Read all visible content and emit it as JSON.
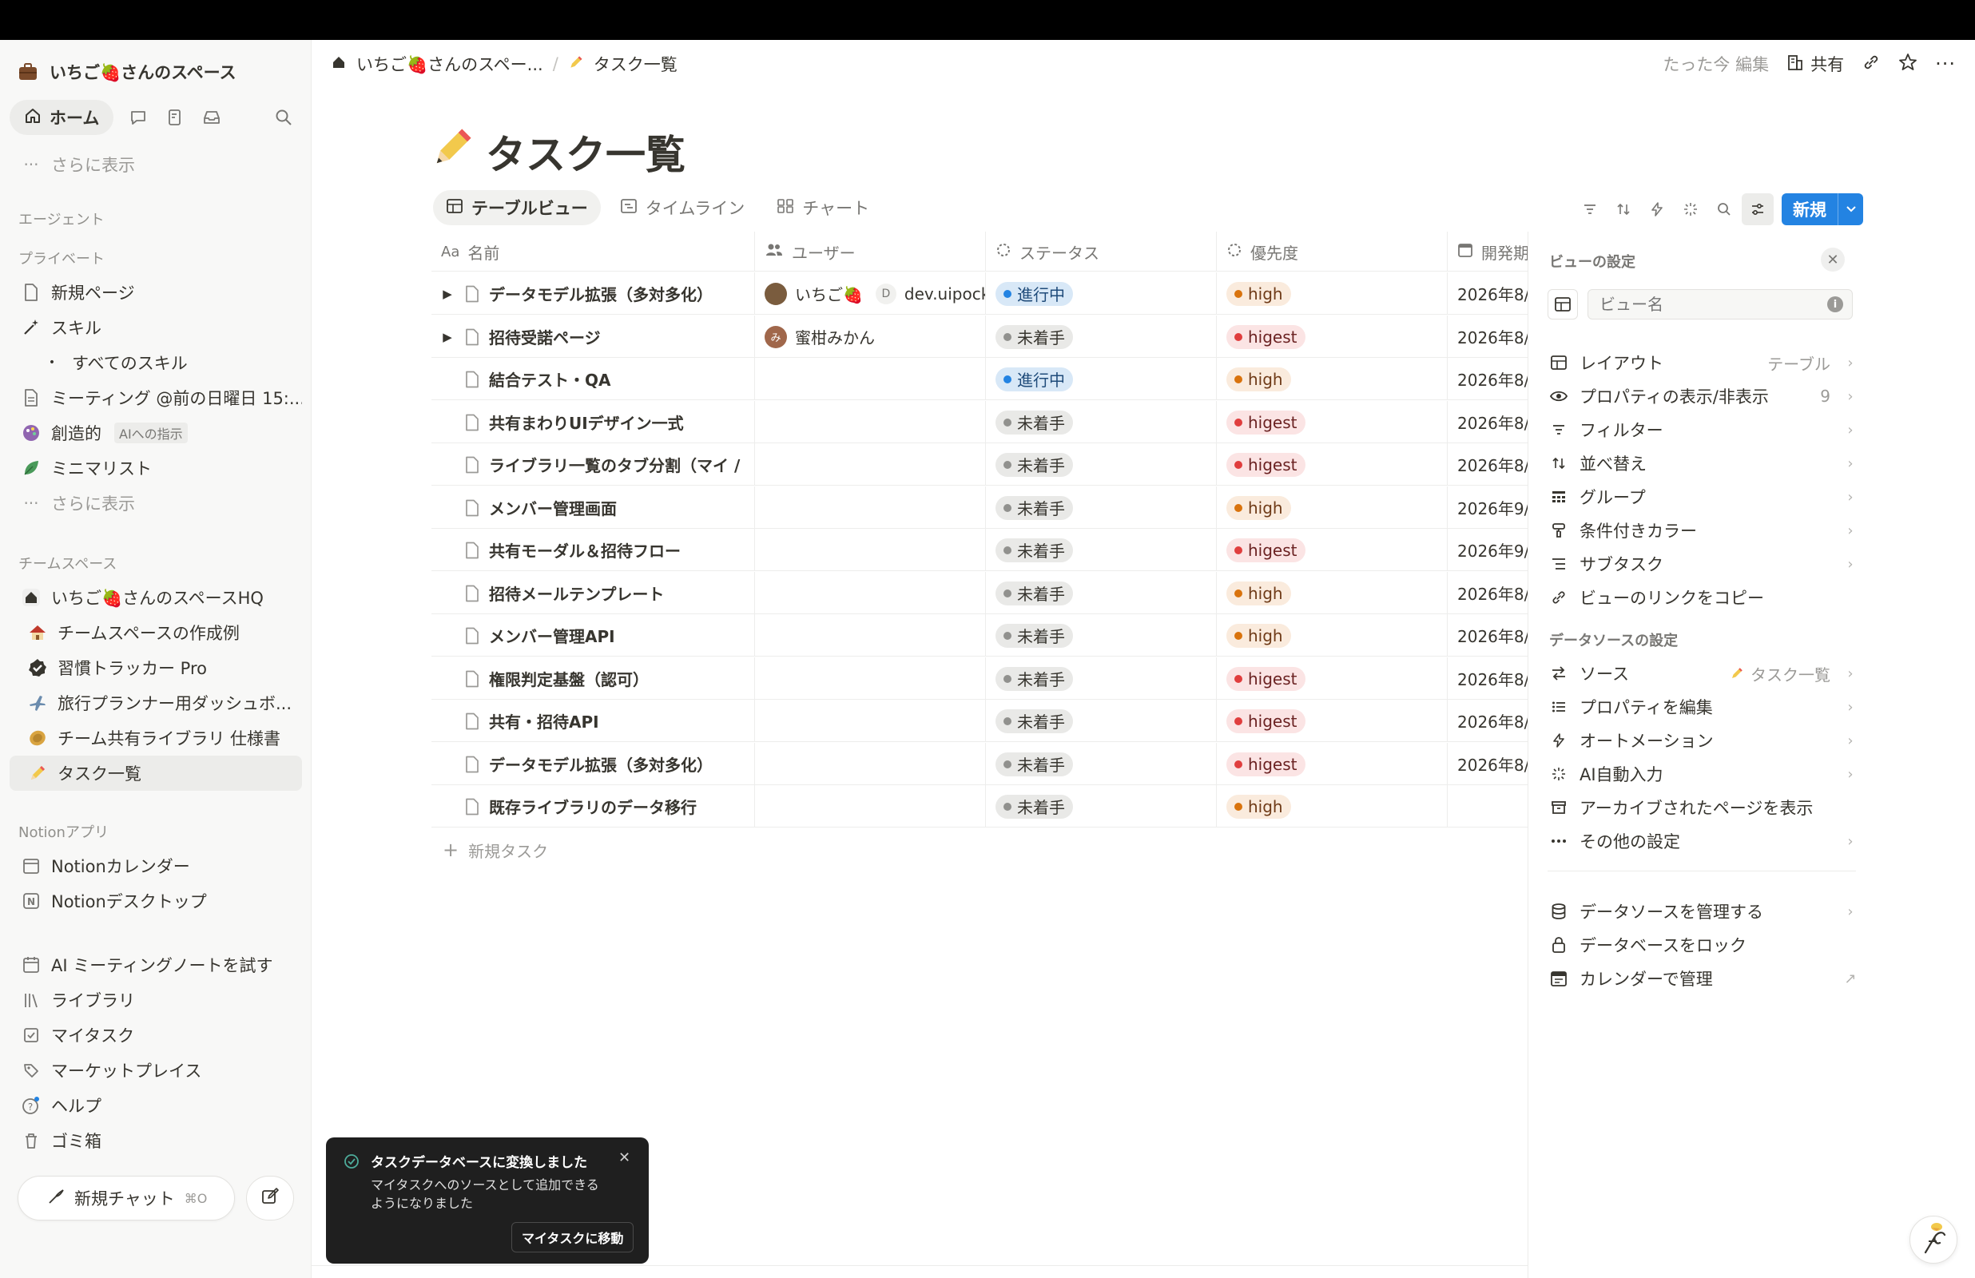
{
  "colors": {
    "accent": "#2383e2",
    "in_progress": "#2383e2",
    "todo": "#91918e",
    "high": "#d9730d",
    "higest": "#e03e3e"
  },
  "sidebar": {
    "workspace_name": "いちご🍓さんのスペース",
    "home_label": "ホーム",
    "more_top": "さらに表示",
    "agent_section": "エージェント",
    "private_section": "プライベート",
    "private_items": [
      {
        "label": "新規ページ",
        "icon": "page-icon"
      },
      {
        "label": "スキル",
        "icon": "magic-wand-icon"
      },
      {
        "label": "すべてのスキル",
        "icon": "bullet-icon"
      },
      {
        "label": "ミーティング @前の日曜日 15:...",
        "icon": "page-icon"
      },
      {
        "label": "創造的",
        "badge": "AIへの指示",
        "icon": "palette-icon"
      },
      {
        "label": "ミニマリスト",
        "icon": "leaf-icon"
      },
      {
        "label": "さらに表示",
        "icon": "dots-icon"
      }
    ],
    "team_section": "チームスペース",
    "team_items": [
      {
        "label": "いちご🍓さんのスペースHQ",
        "icon": "house-icon"
      },
      {
        "label": "チームスペースの作成例",
        "icon": "house-emoji-icon"
      },
      {
        "label": "習慣トラッカー Pro",
        "icon": "check-badge-icon"
      },
      {
        "label": "旅行プランナー用ダッシュボ...",
        "icon": "airplane-icon"
      },
      {
        "label": "チーム共有ライブラリ 仕様書",
        "icon": "coin-icon"
      },
      {
        "label": "タスク一覧",
        "icon": "pencil-icon"
      }
    ],
    "apps_section": "Notionアプリ",
    "app_items": [
      {
        "label": "Notionカレンダー",
        "icon": "calendar-app-icon"
      },
      {
        "label": "Notionデスクトップ",
        "icon": "notion-app-icon"
      }
    ],
    "bottom_items": [
      {
        "label": "AI ミーティングノートを試す",
        "icon": "calendar-icon"
      },
      {
        "label": "ライブラリ",
        "icon": "library-icon"
      },
      {
        "label": "マイタスク",
        "icon": "checkbox-icon"
      },
      {
        "label": "マーケットプレイス",
        "icon": "marketplace-icon"
      },
      {
        "label": "ヘルプ",
        "icon": "help-icon"
      },
      {
        "label": "ゴミ箱",
        "icon": "trash-icon"
      }
    ],
    "new_chat": "新規チャット",
    "new_chat_shortcut": "⌘O"
  },
  "header": {
    "breadcrumb_1": "いちご🍓さんのスペー...",
    "breadcrumb_2": "タスク一覧",
    "edited": "たった今 編集",
    "share": "共有"
  },
  "page": {
    "title": "タスク一覧",
    "title_icon": "✏️"
  },
  "views": {
    "tabs": [
      "テーブルビュー",
      "タイムライン",
      "チャート"
    ],
    "active": "テーブルビュー"
  },
  "toolbar": {
    "new_label": "新規"
  },
  "table": {
    "columns": [
      "名前",
      "ユーザー",
      "ステータス",
      "優先度",
      "開発期"
    ],
    "rows": [
      {
        "name": "データモデル拡張（多対多化）",
        "expand": true,
        "user": "いちご🍓",
        "user2": "dev.uipocke",
        "status": "進行中",
        "priority": "high",
        "date": "2026年8/"
      },
      {
        "name": "招待受諾ページ",
        "expand": true,
        "user": "蜜柑みかん",
        "user2": "",
        "status": "未着手",
        "priority": "higest",
        "date": "2026年8/"
      },
      {
        "name": "結合テスト・QA",
        "expand": false,
        "user": "",
        "user2": "",
        "status": "進行中",
        "priority": "high",
        "date": "2026年8/"
      },
      {
        "name": "共有まわりUIデザイン一式",
        "expand": false,
        "user": "",
        "user2": "",
        "status": "未着手",
        "priority": "higest",
        "date": "2026年8/"
      },
      {
        "name": "ライブラリ一覧のタブ分割（マイ /",
        "expand": false,
        "user": "",
        "user2": "",
        "status": "未着手",
        "priority": "higest",
        "date": "2026年8/"
      },
      {
        "name": "メンバー管理画面",
        "expand": false,
        "user": "",
        "user2": "",
        "status": "未着手",
        "priority": "high",
        "date": "2026年9/"
      },
      {
        "name": "共有モーダル＆招待フロー",
        "expand": false,
        "user": "",
        "user2": "",
        "status": "未着手",
        "priority": "higest",
        "date": "2026年9/"
      },
      {
        "name": "招待メールテンプレート",
        "expand": false,
        "user": "",
        "user2": "",
        "status": "未着手",
        "priority": "high",
        "date": "2026年8/"
      },
      {
        "name": "メンバー管理API",
        "expand": false,
        "user": "",
        "user2": "",
        "status": "未着手",
        "priority": "high",
        "date": "2026年8/"
      },
      {
        "name": "権限判定基盤（認可）",
        "expand": false,
        "user": "",
        "user2": "",
        "status": "未着手",
        "priority": "higest",
        "date": "2026年8/"
      },
      {
        "name": "共有・招待API",
        "expand": false,
        "user": "",
        "user2": "",
        "status": "未着手",
        "priority": "higest",
        "date": "2026年8/"
      },
      {
        "name": "データモデル拡張（多対多化）",
        "expand": false,
        "user": "",
        "user2": "",
        "status": "未着手",
        "priority": "higest",
        "date": "2026年8/"
      },
      {
        "name": "既存ライブラリのデータ移行",
        "expand": false,
        "user": "",
        "user2": "",
        "status": "未着手",
        "priority": "high",
        "date": ""
      }
    ],
    "add_label": "新規タスク"
  },
  "panel": {
    "title": "ビューの設定",
    "view_name_placeholder": "ビュー名",
    "view_items": [
      {
        "label": "レイアウト",
        "value": "テーブル",
        "icon": "table-icon"
      },
      {
        "label": "プロパティの表示/非表示",
        "value": "9",
        "icon": "eye-icon"
      },
      {
        "label": "フィルター",
        "value": "",
        "icon": "filter-icon"
      },
      {
        "label": "並べ替え",
        "value": "",
        "icon": "sort-icon"
      },
      {
        "label": "グループ",
        "value": "",
        "icon": "group-icon"
      },
      {
        "label": "条件付きカラー",
        "value": "",
        "icon": "paint-icon"
      },
      {
        "label": "サブタスク",
        "value": "",
        "icon": "subtask-icon"
      },
      {
        "label": "ビューのリンクをコピー",
        "value": "",
        "icon": "link-icon"
      }
    ],
    "ds_title": "データソースの設定",
    "ds_items": [
      {
        "label": "ソース",
        "value": "タスク一覧",
        "icon": "source-icon"
      },
      {
        "label": "プロパティを編集",
        "value": "",
        "icon": "list-icon"
      },
      {
        "label": "オートメーション",
        "value": "",
        "icon": "bolt-icon"
      },
      {
        "label": "AI自動入力",
        "value": "",
        "icon": "sparkle-icon"
      },
      {
        "label": "アーカイブされたページを表示",
        "value": "",
        "icon": "archive-icon"
      },
      {
        "label": "その他の設定",
        "value": "",
        "icon": "dots-icon"
      }
    ],
    "manage_items": [
      {
        "label": "データソースを管理する",
        "icon": "database-icon"
      },
      {
        "label": "データベースをロック",
        "icon": "lock-icon"
      },
      {
        "label": "カレンダーで管理",
        "icon": "calendar-icon"
      }
    ]
  },
  "toast": {
    "title": "タスクデータベースに変換しました",
    "body": "マイタスクへのソースとして追加できるようになりました",
    "button": "マイタスクに移動"
  }
}
